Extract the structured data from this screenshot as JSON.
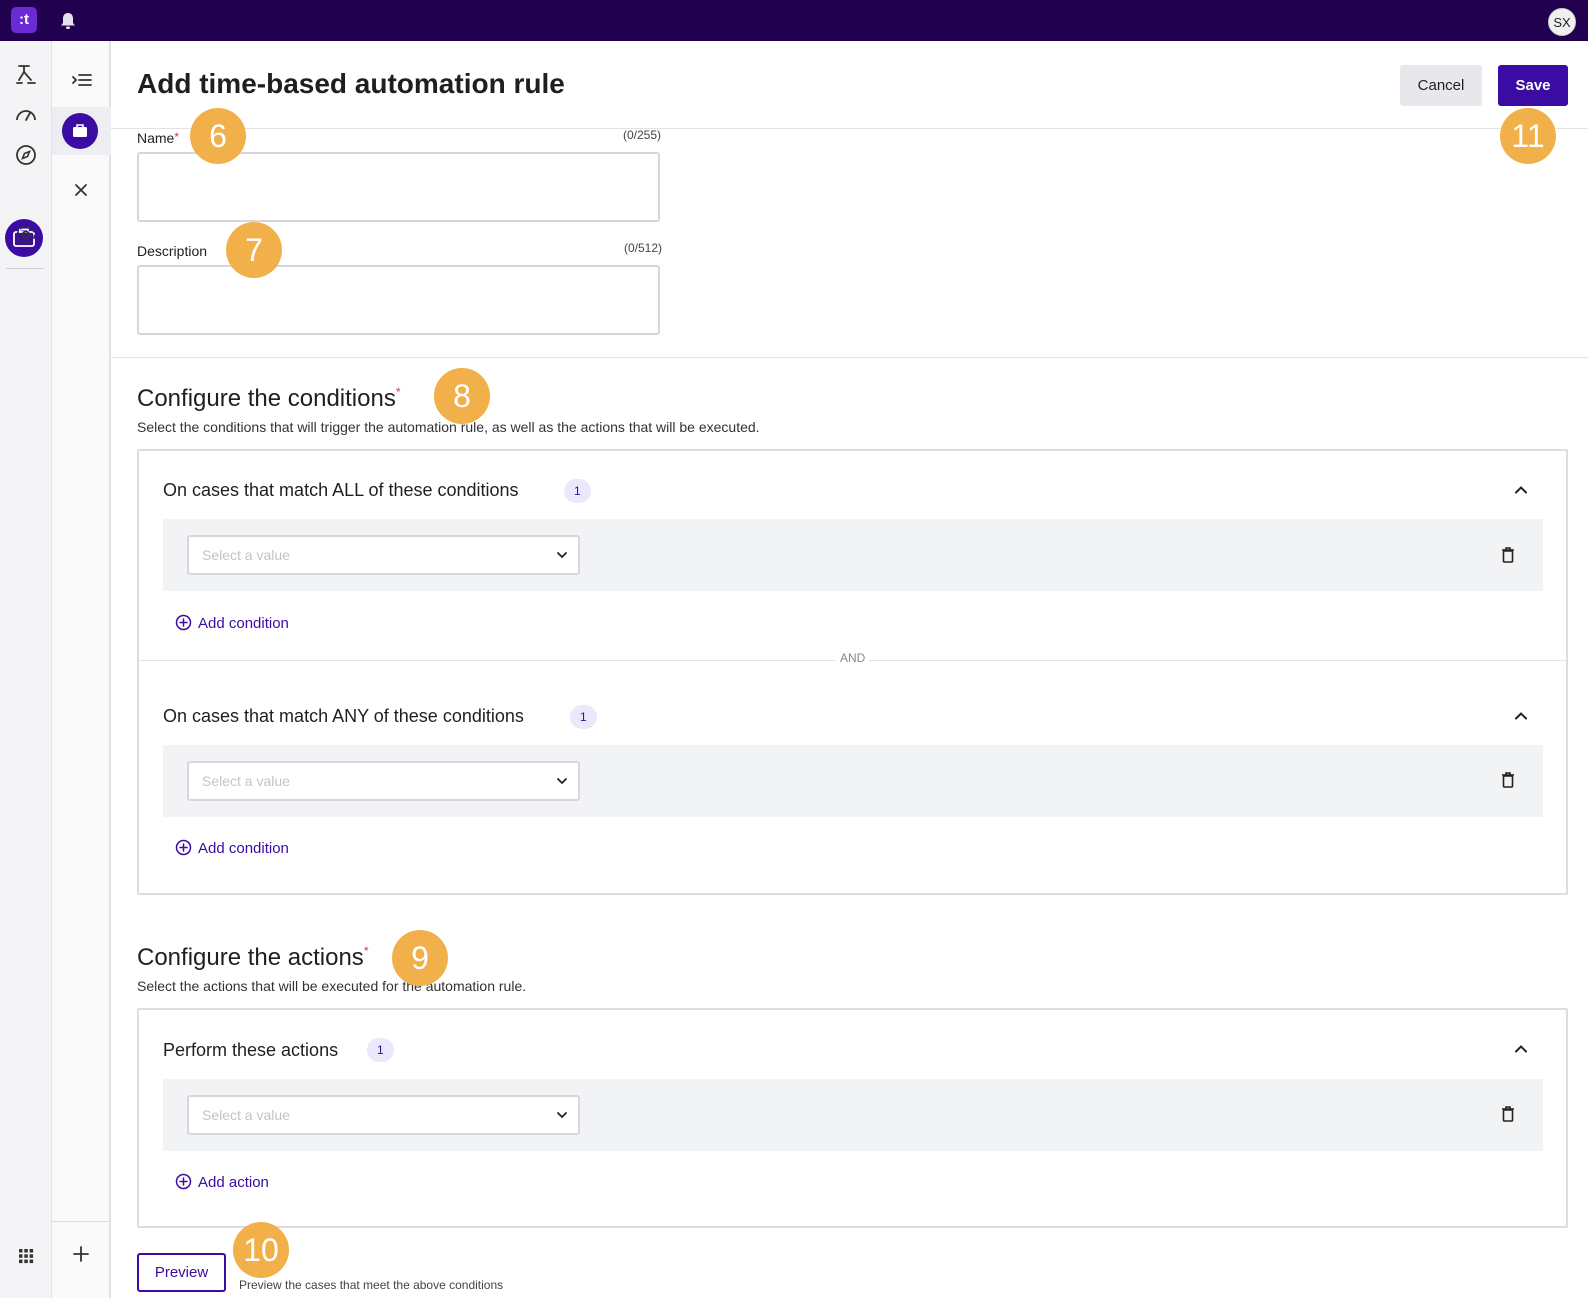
{
  "topbar": {
    "logo_text": ":t",
    "avatar_initials": "SX"
  },
  "page": {
    "title": "Add time-based automation rule"
  },
  "toolbar": {
    "cancel_label": "Cancel",
    "save_label": "Save"
  },
  "form": {
    "name": {
      "label": "Name",
      "required": "*",
      "counter": "(0/255)",
      "value": ""
    },
    "description": {
      "label": "Description",
      "counter": "(0/512)",
      "value": ""
    }
  },
  "conditions": {
    "title": "Configure the conditions",
    "required": "*",
    "description": "Select the conditions that will trigger the automation rule, as well as the actions that will be executed.",
    "all_group": {
      "title": "On cases that match ALL of these conditions",
      "count": "1",
      "select_placeholder": "Select a value",
      "add_label": "Add condition"
    },
    "separator": "AND",
    "any_group": {
      "title": "On cases that match ANY of these conditions",
      "count": "1",
      "select_placeholder": "Select a value",
      "add_label": "Add condition"
    }
  },
  "actions": {
    "title": "Configure the actions",
    "required": "*",
    "description": "Select the actions that will be executed for the automation rule.",
    "group": {
      "title": "Perform these actions",
      "count": "1",
      "select_placeholder": "Select a value",
      "add_label": "Add action"
    }
  },
  "preview": {
    "button_label": "Preview",
    "hint": "Preview the cases that meet the above conditions"
  },
  "markers": [
    "6",
    "7",
    "8",
    "9",
    "10",
    "11"
  ],
  "colors": {
    "topbar": "#21004f",
    "brand": "#3a0ca3",
    "marker": "#f2b04a",
    "badge_bg": "#ece8fb"
  }
}
